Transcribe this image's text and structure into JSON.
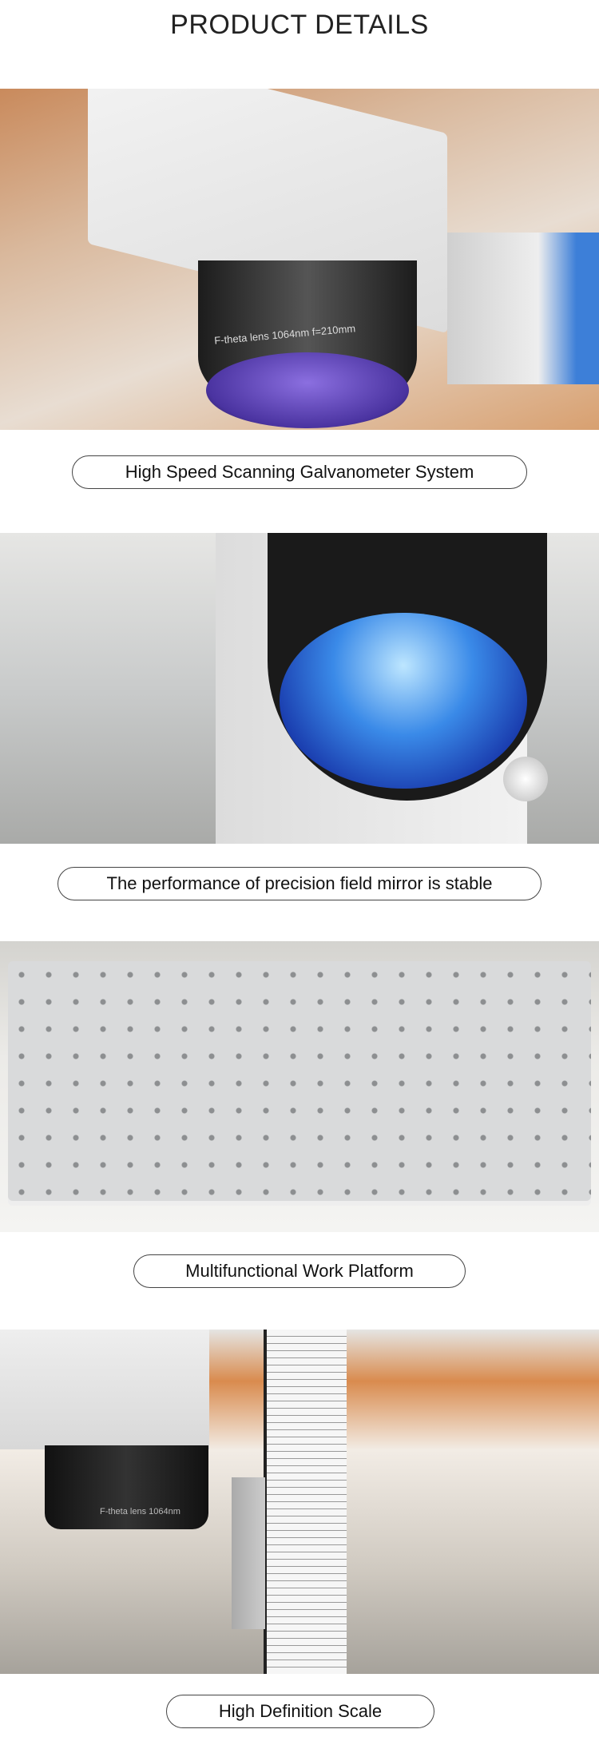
{
  "page": {
    "title": "PRODUCT DETAILS"
  },
  "sections": [
    {
      "caption": "High Speed Scanning Galvanometer System",
      "lens_text": "F-theta lens 1064nm f=210mm"
    },
    {
      "caption": "The performance of precision field mirror is stable"
    },
    {
      "caption": "Multifunctional Work Platform"
    },
    {
      "caption": "High Definition Scale",
      "lens_text": "F-theta lens 1064nm"
    }
  ],
  "colors": {
    "text": "#222222",
    "border": "#444444",
    "lens_blue": "#2a5fd0",
    "lens_purple": "#6a4fc0"
  }
}
